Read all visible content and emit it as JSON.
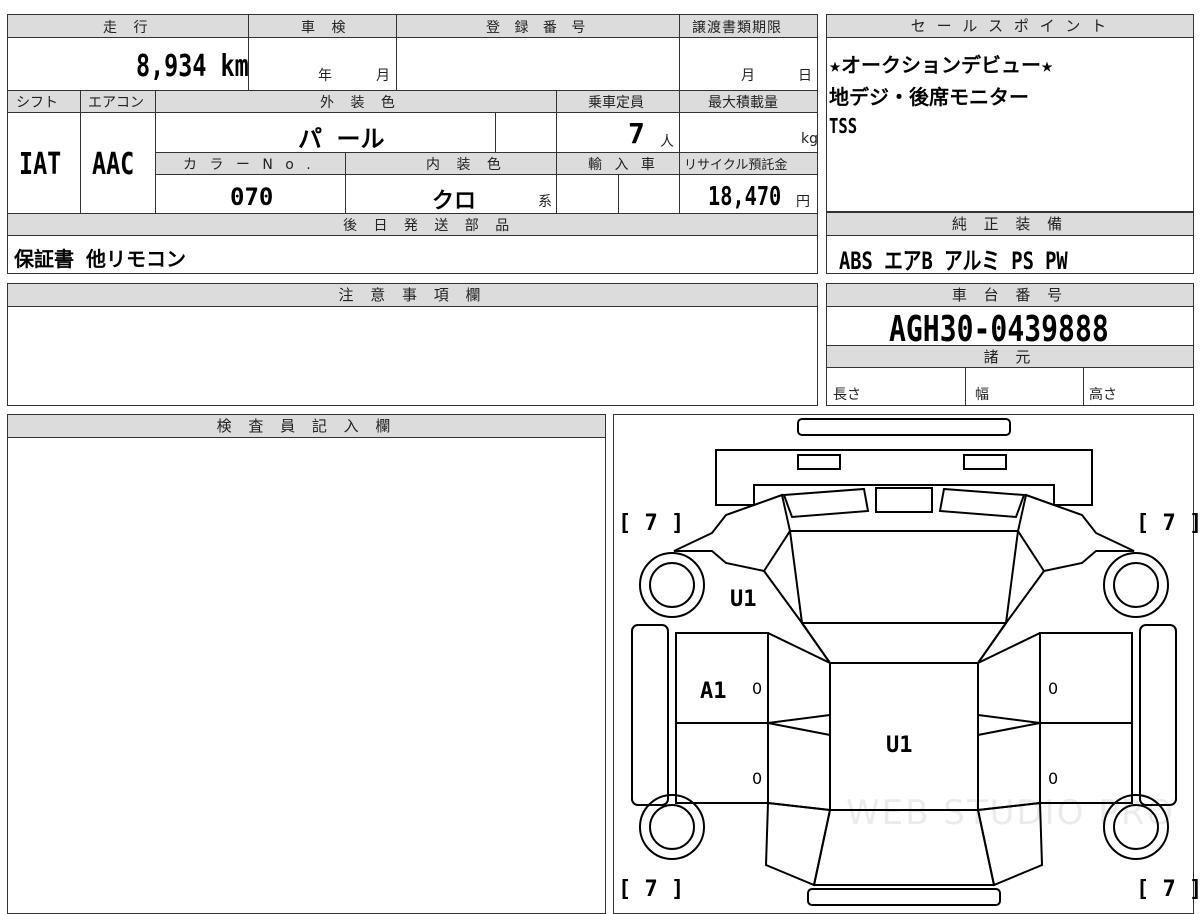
{
  "top_left": {
    "mileage_label": "走 行",
    "mileage_value": "8,934",
    "mileage_unit": "km",
    "inspection_label": "車 検",
    "inspection_year": "年",
    "inspection_month": "月",
    "registration_label": "登 録 番 号",
    "transfer_label": "譲渡書類期限",
    "transfer_month": "月",
    "transfer_day": "日",
    "shift_label": "シフト",
    "shift_value": "IAT",
    "ac_label": "エアコン",
    "ac_value": "AAC",
    "exterior_label": "外 装 色",
    "exterior_value": "パ ール",
    "capacity_label": "乗車定員",
    "capacity_value": "7",
    "capacity_unit": "人",
    "maxload_label": "最大積載量",
    "maxload_unit": "kg",
    "colorno_label": "カ ラ ー N o .",
    "colorno_value": "070",
    "interior_label": "内 装 色",
    "interior_value": "クロ",
    "interior_suffix": "系",
    "import_label": "輸 入 車",
    "recycle_label": "リサイクル預託金",
    "recycle_value": "18,470",
    "recycle_unit": "円",
    "later_label": "後 日 発 送 部 品",
    "later_value": "保証書 他リモコン"
  },
  "sales_points": {
    "label": "セ ー ル ス ポ イ ン ト",
    "lines": [
      "★オークションデビュー★",
      "地デジ・後席モニター",
      "TSS"
    ]
  },
  "equipment": {
    "label": "純 正 装 備",
    "value": "ABS  エアB  アルミ  PS  PW"
  },
  "notes": {
    "label": "注 意 事 項 欄"
  },
  "chassis": {
    "label": "車 台 番 号",
    "value": "AGH30-0439888",
    "specs_label": "諸 元",
    "length_label": "長さ",
    "width_label": "幅",
    "height_label": "高さ"
  },
  "inspector": {
    "label": "検 査 員 記 入 欄"
  },
  "diagram": {
    "tire_fl": "[ 7 ]",
    "tire_fr": "[ 7 ]",
    "tire_rl": "[ 7 ]",
    "tire_rr": "[ 7 ]",
    "mark_u1_front": "U1",
    "mark_a1": "A1",
    "mark_u1_roof": "U1",
    "door_marks": [
      "0",
      "0",
      "0",
      "0"
    ],
    "watermark": "WEB STUDIO PRO"
  }
}
